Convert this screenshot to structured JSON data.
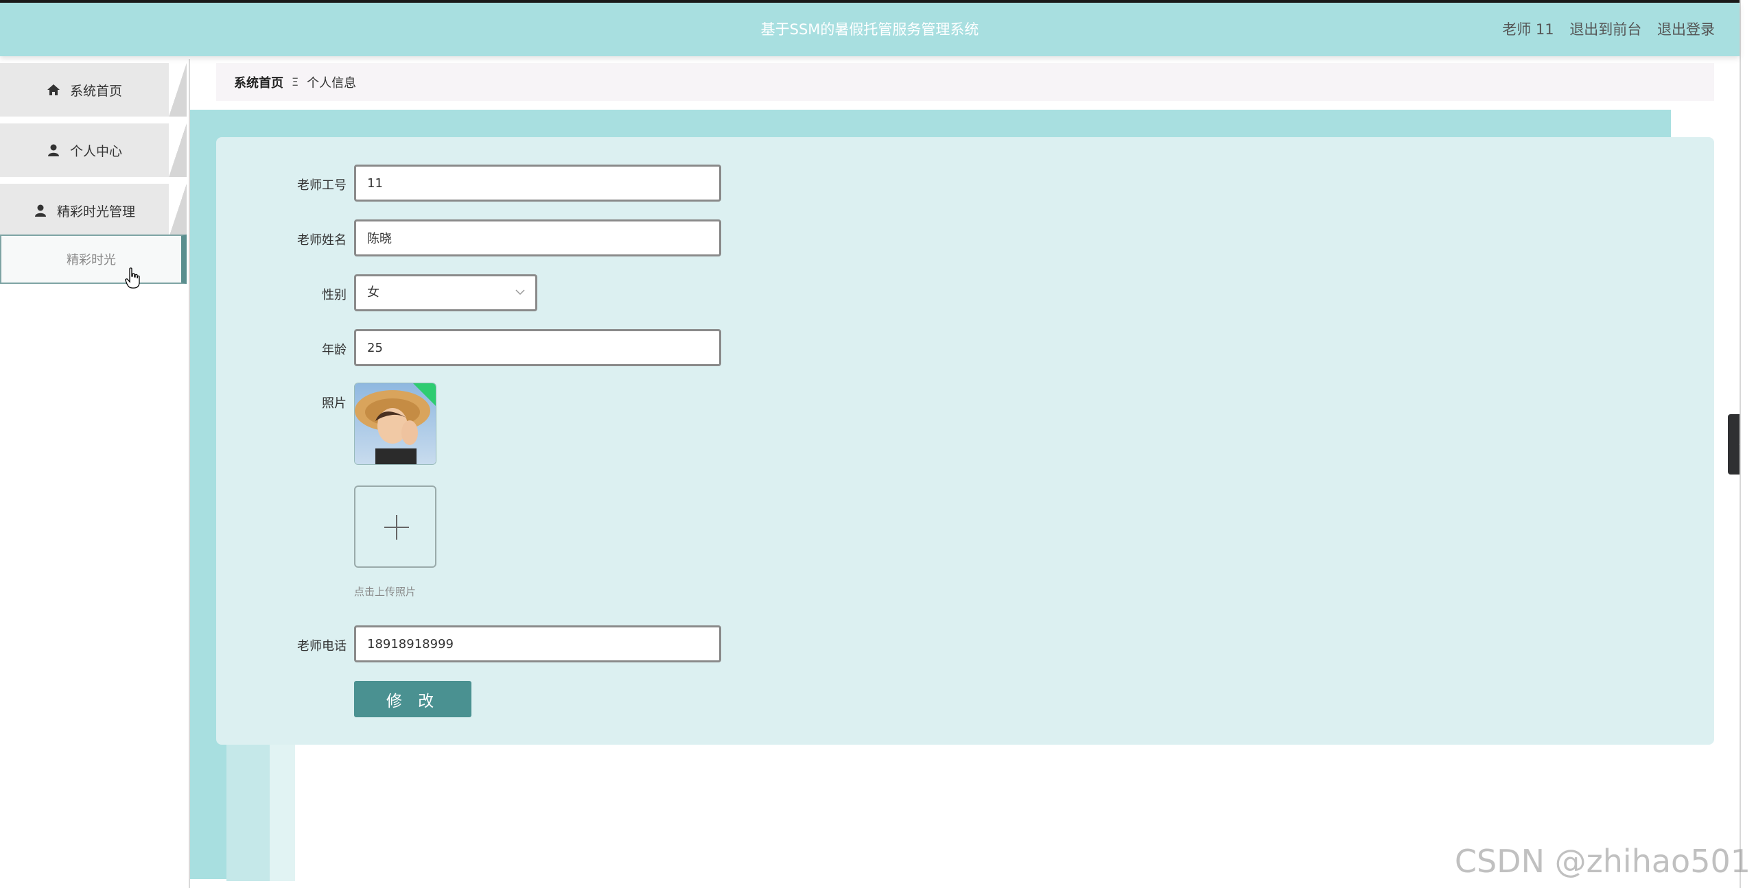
{
  "header": {
    "title": "基于SSM的暑假托管服务管理系统",
    "user_label": "老师 11",
    "to_front_label": "退出到前台",
    "logout_label": "退出登录"
  },
  "sidebar": {
    "items": [
      {
        "label": "系统首页",
        "icon": "home-icon"
      },
      {
        "label": "个人中心",
        "icon": "user-icon"
      },
      {
        "label": "精彩时光管理",
        "icon": "user-icon"
      }
    ],
    "submenu": [
      {
        "label": "精彩时光",
        "active": true
      }
    ]
  },
  "breadcrumb": {
    "home": "系统首页",
    "separator": "Ξ",
    "current": "个人信息"
  },
  "form": {
    "teacher_id": {
      "label": "老师工号",
      "value": "11"
    },
    "teacher_name": {
      "label": "老师姓名",
      "value": "陈晓"
    },
    "gender": {
      "label": "性别",
      "value": "女"
    },
    "age": {
      "label": "年龄",
      "value": "25"
    },
    "photo": {
      "label": "照片",
      "upload_hint": "点击上传照片"
    },
    "phone": {
      "label": "老师电话",
      "value": "18918918999"
    },
    "submit_label": "修 改"
  },
  "watermark": "CSDN @zhihao501",
  "colors": {
    "header_bg": "#a8dfe0",
    "card_bg": "#dcf0f1",
    "button_bg": "#4a9191",
    "menu_bg": "#e8e8e8"
  }
}
